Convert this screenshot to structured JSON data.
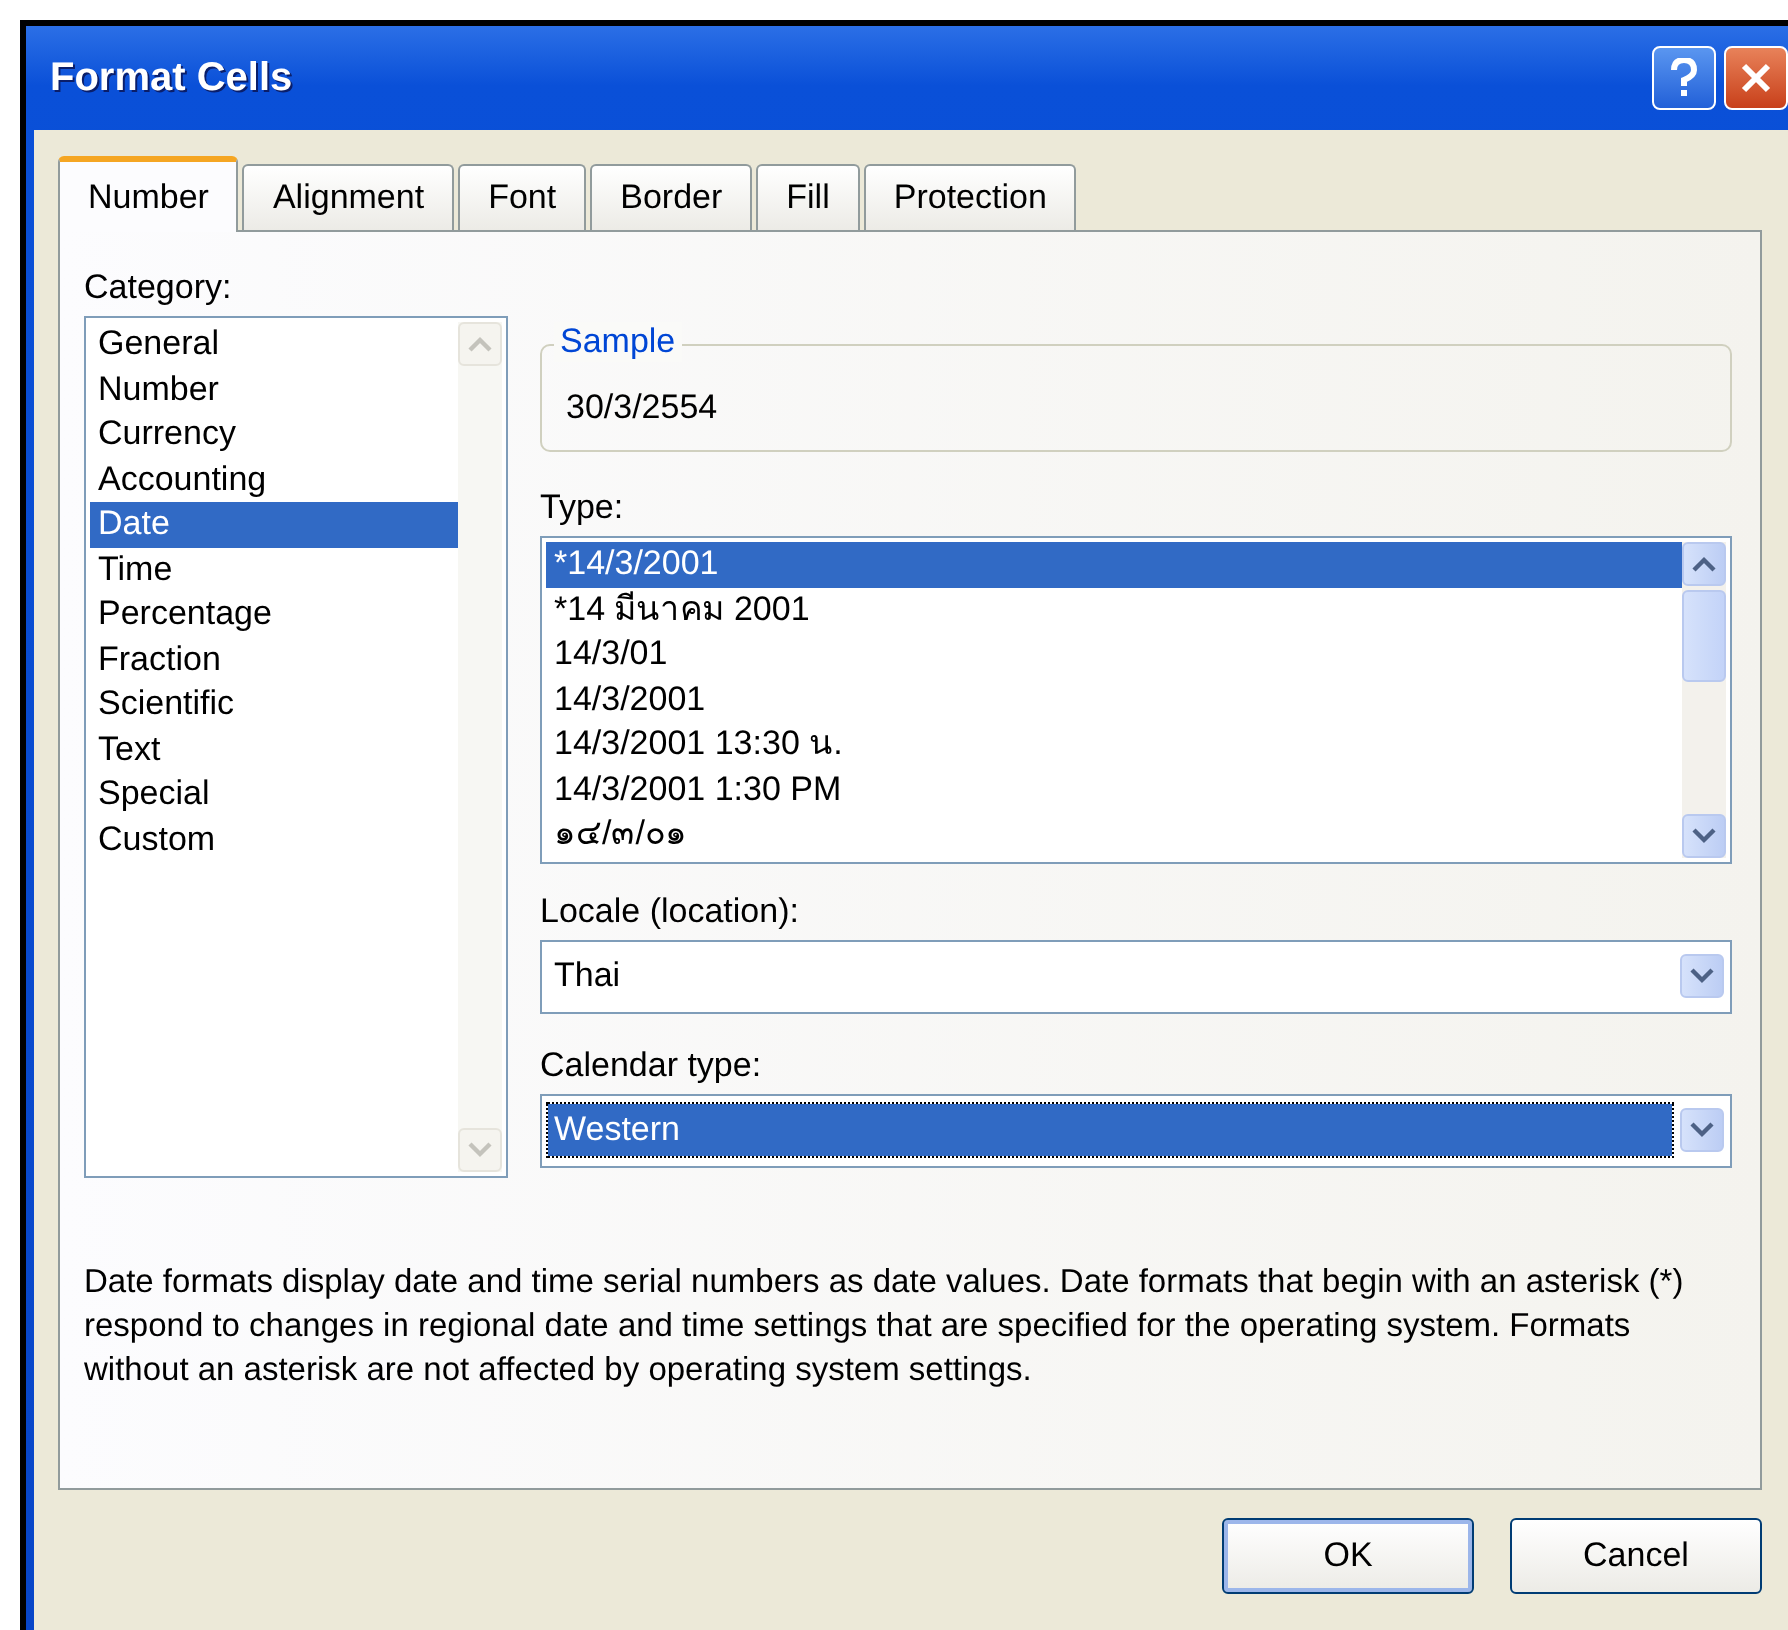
{
  "window": {
    "title": "Format Cells"
  },
  "tabs": [
    {
      "label": "Number",
      "selected": true
    },
    {
      "label": "Alignment",
      "selected": false
    },
    {
      "label": "Font",
      "selected": false
    },
    {
      "label": "Border",
      "selected": false
    },
    {
      "label": "Fill",
      "selected": false
    },
    {
      "label": "Protection",
      "selected": false
    }
  ],
  "category": {
    "label": "Category:",
    "items": [
      {
        "label": "General",
        "selected": false
      },
      {
        "label": "Number",
        "selected": false
      },
      {
        "label": "Currency",
        "selected": false
      },
      {
        "label": "Accounting",
        "selected": false
      },
      {
        "label": "Date",
        "selected": true
      },
      {
        "label": "Time",
        "selected": false
      },
      {
        "label": "Percentage",
        "selected": false
      },
      {
        "label": "Fraction",
        "selected": false
      },
      {
        "label": "Scientific",
        "selected": false
      },
      {
        "label": "Text",
        "selected": false
      },
      {
        "label": "Special",
        "selected": false
      },
      {
        "label": "Custom",
        "selected": false
      }
    ]
  },
  "sample": {
    "label": "Sample",
    "value": "30/3/2554"
  },
  "type": {
    "label": "Type:",
    "items": [
      {
        "label": "*14/3/2001",
        "selected": true
      },
      {
        "label": "*14 มีนาคม 2001",
        "selected": false
      },
      {
        "label": "14/3/01",
        "selected": false
      },
      {
        "label": "14/3/2001",
        "selected": false
      },
      {
        "label": "14/3/2001 13:30 น.",
        "selected": false
      },
      {
        "label": "14/3/2001 1:30 PM",
        "selected": false
      },
      {
        "label": "๑๔/๓/๐๑",
        "selected": false
      }
    ]
  },
  "locale": {
    "label": "Locale (location):",
    "value": "Thai",
    "highlighted": false
  },
  "calendar": {
    "label": "Calendar type:",
    "value": "Western",
    "highlighted": true
  },
  "description": "Date formats display date and time serial numbers as date values.  Date formats that begin with an asterisk (*) respond to changes in regional date and time settings that are specified for the operating system. Formats without an asterisk are not affected by operating system settings.",
  "buttons": [
    {
      "label": "OK",
      "kind": "default"
    },
    {
      "label": "Cancel",
      "kind": "normal"
    }
  ]
}
